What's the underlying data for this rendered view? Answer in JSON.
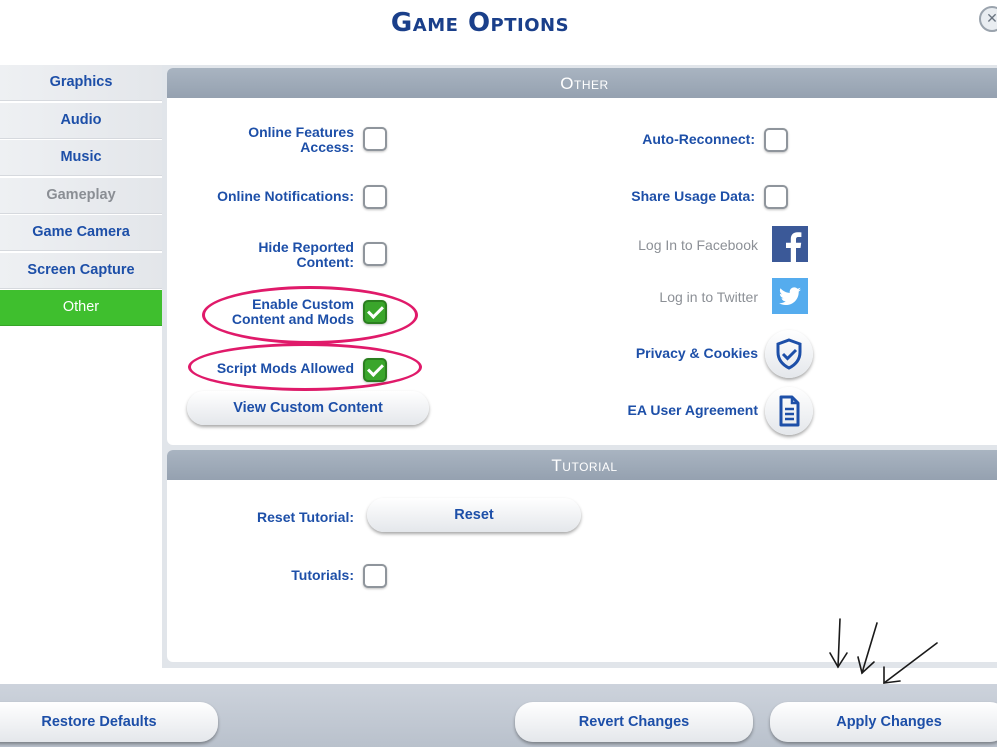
{
  "title": "Game Options",
  "close_glyph": "✕",
  "sidebar": {
    "items": [
      {
        "label": "Graphics",
        "state": "normal"
      },
      {
        "label": "Audio",
        "state": "normal"
      },
      {
        "label": "Music",
        "state": "normal"
      },
      {
        "label": "Gameplay",
        "state": "dim"
      },
      {
        "label": "Game Camera",
        "state": "normal"
      },
      {
        "label": "Screen Capture",
        "state": "normal"
      },
      {
        "label": "Other",
        "state": "active"
      }
    ]
  },
  "other": {
    "header": "Other",
    "online_features": {
      "label_line1": "Online Features",
      "label_line2": "Access:",
      "checked": false
    },
    "online_notifications": {
      "label": "Online Notifications:",
      "checked": false
    },
    "hide_reported": {
      "label_line1": "Hide Reported",
      "label_line2": "Content:",
      "checked": false
    },
    "enable_custom": {
      "label_line1": "Enable Custom",
      "label_line2": "Content and Mods",
      "checked": true
    },
    "script_mods": {
      "label": "Script Mods Allowed",
      "checked": true
    },
    "view_custom_button": "View Custom Content",
    "auto_reconnect": {
      "label": "Auto-Reconnect:",
      "checked": false
    },
    "share_usage": {
      "label": "Share Usage Data:",
      "checked": false
    },
    "facebook": {
      "label": "Log In to Facebook",
      "icon": "facebook-icon"
    },
    "twitter": {
      "label": "Log in to Twitter",
      "icon": "twitter-icon"
    },
    "privacy": {
      "label": "Privacy & Cookies",
      "icon": "shield-check-icon"
    },
    "ea_agreement": {
      "label": "EA User Agreement",
      "icon": "document-icon"
    }
  },
  "tutorial": {
    "header": "Tutorial",
    "reset_label": "Reset Tutorial:",
    "reset_button": "Reset",
    "tutorials_label": "Tutorials:",
    "tutorials_checked": false
  },
  "footer": {
    "restore_defaults": "Restore Defaults",
    "revert_changes": "Revert Changes",
    "apply_changes": "Apply Changes"
  },
  "colors": {
    "accent_blue": "#1d4fa8",
    "active_green": "#3fbf2e",
    "highlight_pink": "#e01a6a",
    "facebook_blue": "#3b5998",
    "twitter_blue": "#55acee"
  }
}
